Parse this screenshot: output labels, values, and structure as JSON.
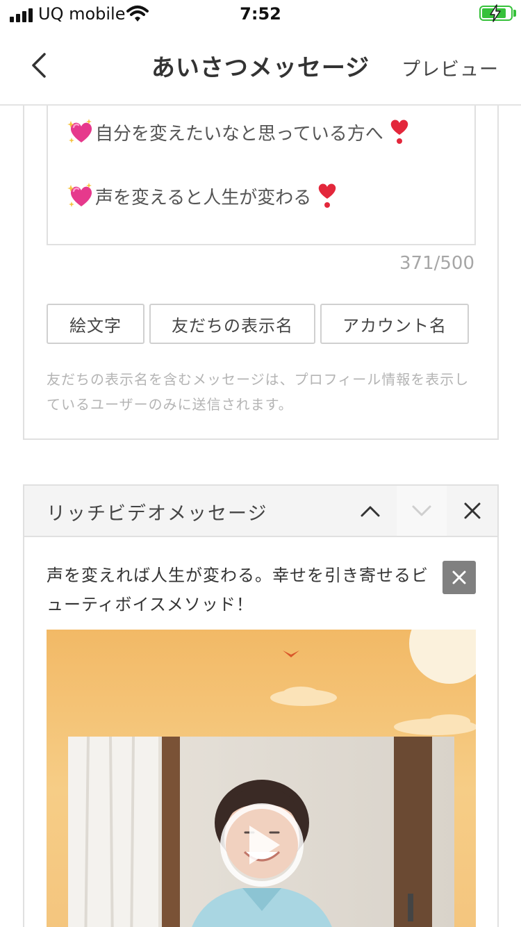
{
  "status_bar": {
    "carrier": "UQ mobile",
    "time": "7:52",
    "battery_color": "#36c13a"
  },
  "nav": {
    "back_icon": "chevron-left-icon",
    "title": "あいさつメッセージ",
    "preview_label": "プレビュー"
  },
  "greeting_card": {
    "lines": [
      "自分を変えたいなと思っている方へ",
      "声を変えると人生が変わる"
    ],
    "line_icons": [
      "sparkling-heart-icon",
      "heart-exclamation-icon"
    ],
    "char_count": "371/500",
    "chips": [
      "絵文字",
      "友だちの表示名",
      "アカウント名"
    ],
    "note": "友だちの表示名を含むメッセージは、プロフィール情報を表示しているユーザーのみに送信されます。"
  },
  "rich_video_card": {
    "title": "リッチビデオメッセージ",
    "up_icon": "chevron-up-icon",
    "down_icon": "chevron-down-icon",
    "close_icon": "close-icon",
    "caption": "声を変えれば人生が変わる。幸せを引き寄せるビューティボイスメソッド！",
    "play_icon": "play-icon"
  }
}
